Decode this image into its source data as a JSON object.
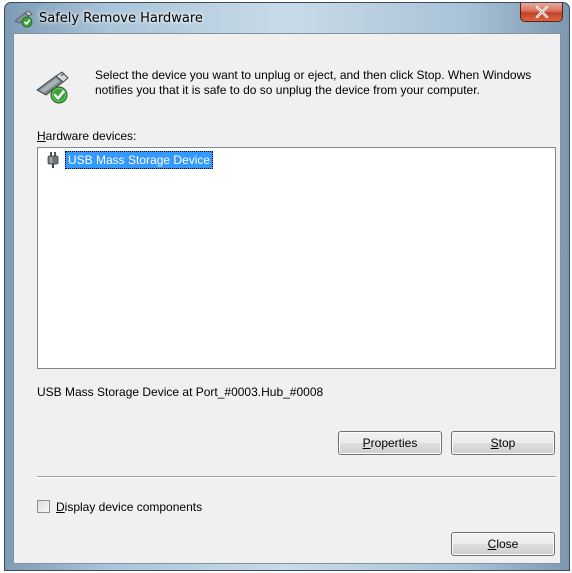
{
  "window": {
    "title": "Safely Remove Hardware",
    "icons": {
      "app": "usb-plug-check-icon",
      "close": "close-icon"
    }
  },
  "instructions": "Select the device you want to unplug or eject, and then click Stop. When Windows notifies you that it is safe to do so unplug the device from your computer.",
  "hardware_label": {
    "mnemonic": "H",
    "rest": "ardware devices:"
  },
  "devices": [
    {
      "name": "USB Mass Storage Device",
      "icon": "usb-plug-icon",
      "selected": true
    }
  ],
  "status_text": "USB Mass Storage Device at Port_#0003.Hub_#0008",
  "buttons": {
    "properties": {
      "mnemonic": "P",
      "rest": "roperties"
    },
    "stop": {
      "mnemonic": "S",
      "rest": "top"
    },
    "close": {
      "mnemonic": "C",
      "rest": "lose"
    }
  },
  "display_components": {
    "mnemonic": "D",
    "rest": "isplay device components",
    "checked": false
  },
  "colors": {
    "selection": "#3399ff",
    "close_button": "#c2412a",
    "dialog_bg": "#f0f0f0"
  }
}
